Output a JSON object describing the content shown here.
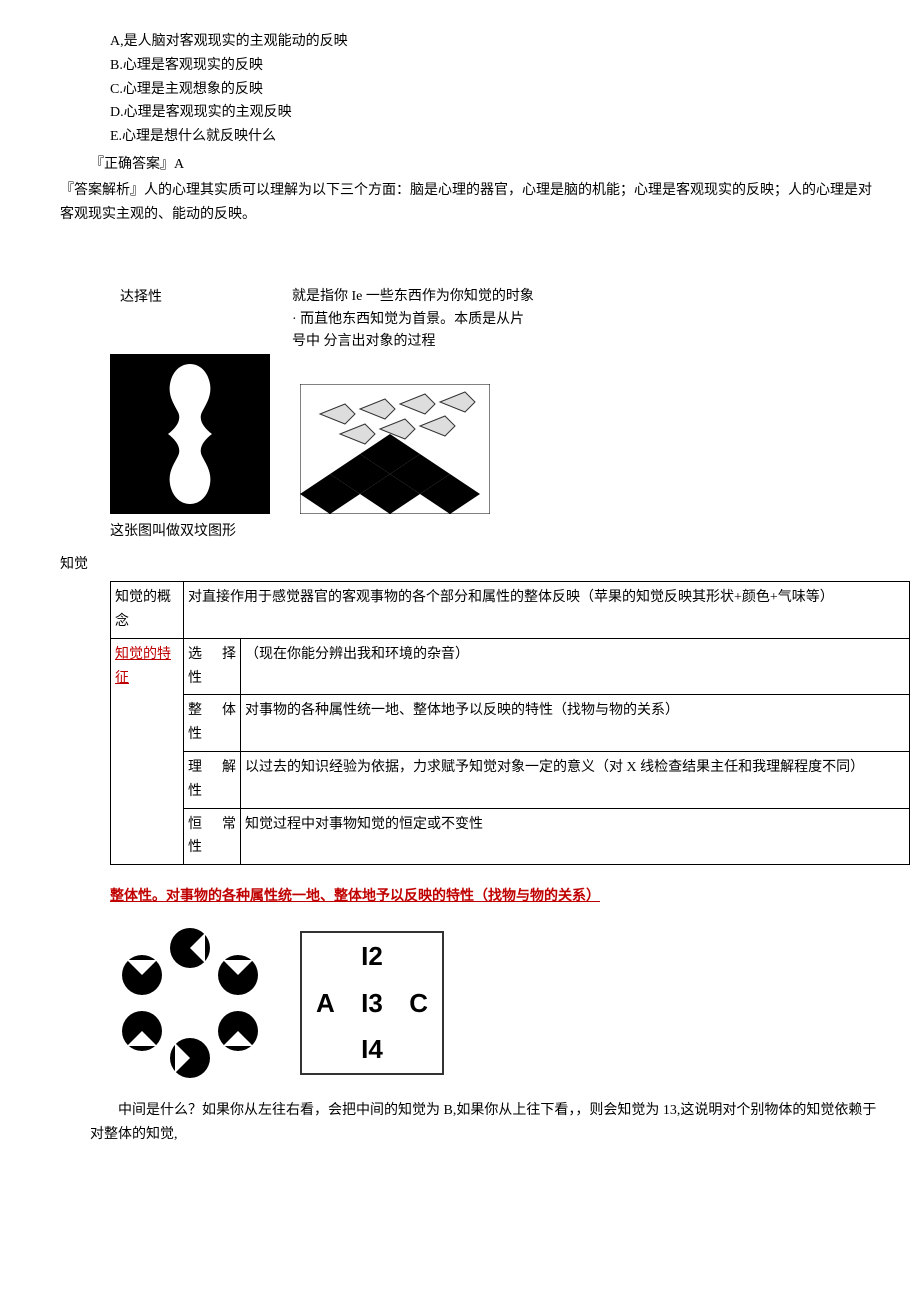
{
  "options": {
    "a": "A,是人脑对客观现实的主观能动的反映",
    "b": "B.心理是客观现实的反映",
    "c": "C.心理是主观想象的反映",
    "d": "D.心理是客观现实的主观反映",
    "e": "E.心理是想什么就反映什么"
  },
  "correct": "『正确答案』A",
  "explain": "『答案解析』人的心理其实质可以理解为以下三个方面：脑是心理的器官，心理是脑的机能；心理是客观现实的反映；人的心理是对客观现实主观的、能动的反映。",
  "select_label": "达择性",
  "select_desc1": "就是指你 Ie 一些东西作为你知觉的时象",
  "select_desc2": "· 而苴他东西知觉为首景。本质是从片",
  "select_desc3": "号中 分言出对象的过程",
  "vase_caption": "这张图叫做双坟图形",
  "zhijue_label": "知觉",
  "table": {
    "row1h": "知觉的概念",
    "row1v": "对直接作用于感觉器官的客观事物的各个部分和属性的整体反映（苹果的知觉反映其形状+颜色+气味等）",
    "row2h": "知觉的特征",
    "r2a_h": "选　择性",
    "r2a_v": "（现在你能分辨出我和环境的杂音）",
    "r2b_h": "整　体性",
    "r2b_v": "对事物的各种属性统一地、整体地予以反映的特性（找物与物的关系）",
    "r2c_h": "理　解性",
    "r2c_v": "以过去的知识经验为依据，力求赋予知觉对象一定的意义（对 X 线检查结果主任和我理解程度不同）",
    "r2d_h": "恒　常性",
    "r2d_v": "知觉过程中对事物知觉的恒定或不变性"
  },
  "emph": "整体性。对事物的各种属性统一地、整体地予以反映的特性（找物与物的关系）",
  "letters": {
    "top": "I2",
    "left": "A",
    "mid": "I3",
    "right": "C",
    "bot": "I4"
  },
  "bottom": "中间是什么？如果你从左往右看，会把中间的知觉为 B,如果你从上往下看，，则会知觉为 13,这说明对个别物体的知觉依赖于对整体的知觉,"
}
